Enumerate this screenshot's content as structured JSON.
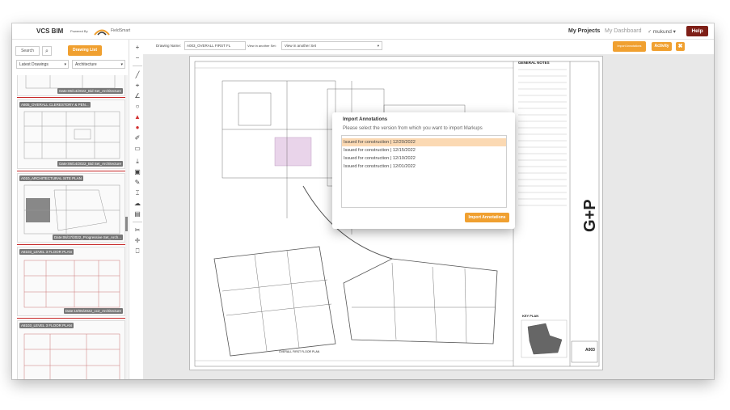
{
  "header": {
    "brand": "VCS BIM",
    "powered_by": "Powered By",
    "partner": "FieldSmart",
    "nav_my_projects": "My Projects",
    "nav_my_dashboard": "My Dashboard",
    "user": "♂ mukund ▾",
    "help": "Help"
  },
  "sidebar": {
    "search_label": "Search",
    "search_icon": "⌕",
    "drawing_list_button": "Drawing List",
    "filter_latest": "Latest Drawings",
    "filter_discipline": "Architecture",
    "drawings": [
      {
        "label": "",
        "date": "Date:06/14/2022_Bid Set_Architecture"
      },
      {
        "label": "A805_OVERALL CLERESTORY & PEN...",
        "date": "Date:06/14/2022_Bid Set_Architecture"
      },
      {
        "label": "A010_ARCHITECTURAL SITE PLAN",
        "date": "Date:06/17/2022_Progressive Set_Arch..."
      },
      {
        "label": "A8103_LEVEL 3 FLOOR PLAN",
        "date": "Date:10/06/2022_cc2_Architecture"
      },
      {
        "label": "A8103_LEVEL 3 FLOOR PLAN",
        "date": ""
      }
    ]
  },
  "toolbar": {
    "zoom_in": "+",
    "zoom_out": "−",
    "tools": [
      "╱",
      "⌖",
      "∠",
      "○",
      "▲",
      "●",
      "✐",
      "▭",
      "⤓",
      "▣",
      "✎",
      "⌶",
      "☁",
      "▤",
      "✂",
      "✛",
      "⎕"
    ]
  },
  "drawing_bar": {
    "name_label": "Drawing Name:",
    "name_value": "A003_OVERALL FIRST FL",
    "view_in_label": "View in another Set:",
    "view_in_value": "View in another Set",
    "import_annotations": "Import Annotations",
    "activity": "Activity",
    "close": "✖"
  },
  "sheet": {
    "general_notes": "GENERAL NOTES",
    "key_plan": "KEY PLAN",
    "plan_title": "OVERALL FIRST FLOOR PLAN",
    "sheet_number": "A003",
    "logo": "G+P"
  },
  "modal": {
    "title": "Import Annotations",
    "subtitle": "Please select the version from which you want to import Markups",
    "versions": [
      {
        "label": "Issued for construction | 12/20/2022",
        "selected": true
      },
      {
        "label": "Issued for construction | 12/15/2022",
        "selected": false
      },
      {
        "label": "Issued for construction | 12/10/2022",
        "selected": false
      },
      {
        "label": "Issued for construction | 12/01/2022",
        "selected": false
      }
    ],
    "import_button": "Import Annotations"
  },
  "colors": {
    "accent": "#f0a030",
    "help": "#7e1f17",
    "selected_row": "#fbd9b3",
    "separator": "#c62828"
  }
}
